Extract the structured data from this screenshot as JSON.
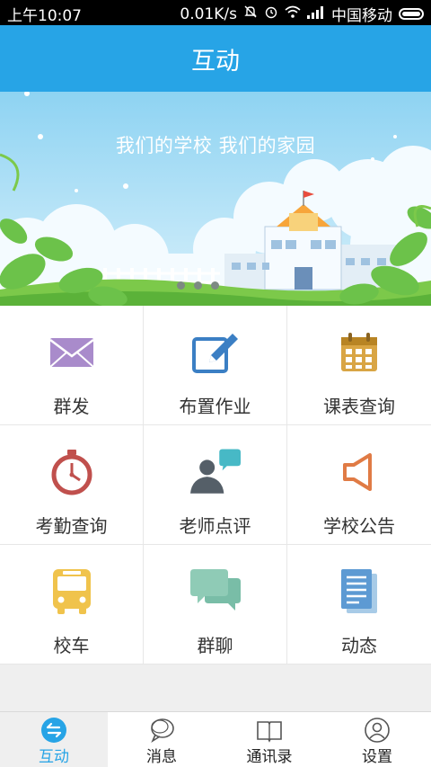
{
  "status_bar": {
    "time": "上午10:07",
    "speed": "0.01K/s",
    "carrier": "中国移动"
  },
  "header": {
    "title": "互动"
  },
  "banner": {
    "slogan": "我们的学校  我们的家园"
  },
  "grid": [
    {
      "label": "群发",
      "icon": "envelope-icon"
    },
    {
      "label": "布置作业",
      "icon": "edit-icon"
    },
    {
      "label": "课表查询",
      "icon": "calendar-icon"
    },
    {
      "label": "考勤查询",
      "icon": "stopwatch-icon"
    },
    {
      "label": "老师点评",
      "icon": "teacher-comment-icon"
    },
    {
      "label": "学校公告",
      "icon": "speaker-icon"
    },
    {
      "label": "校车",
      "icon": "bus-icon"
    },
    {
      "label": "群聊",
      "icon": "chat-bubbles-icon"
    },
    {
      "label": "动态",
      "icon": "document-icon"
    }
  ],
  "tabs": [
    {
      "label": "互动",
      "icon": "interact-icon",
      "active": true
    },
    {
      "label": "消息",
      "icon": "message-icon"
    },
    {
      "label": "通讯录",
      "icon": "contacts-book-icon"
    },
    {
      "label": "设置",
      "icon": "settings-user-icon"
    }
  ],
  "colors": {
    "primary": "#27a4e6",
    "background": "#efefef"
  }
}
